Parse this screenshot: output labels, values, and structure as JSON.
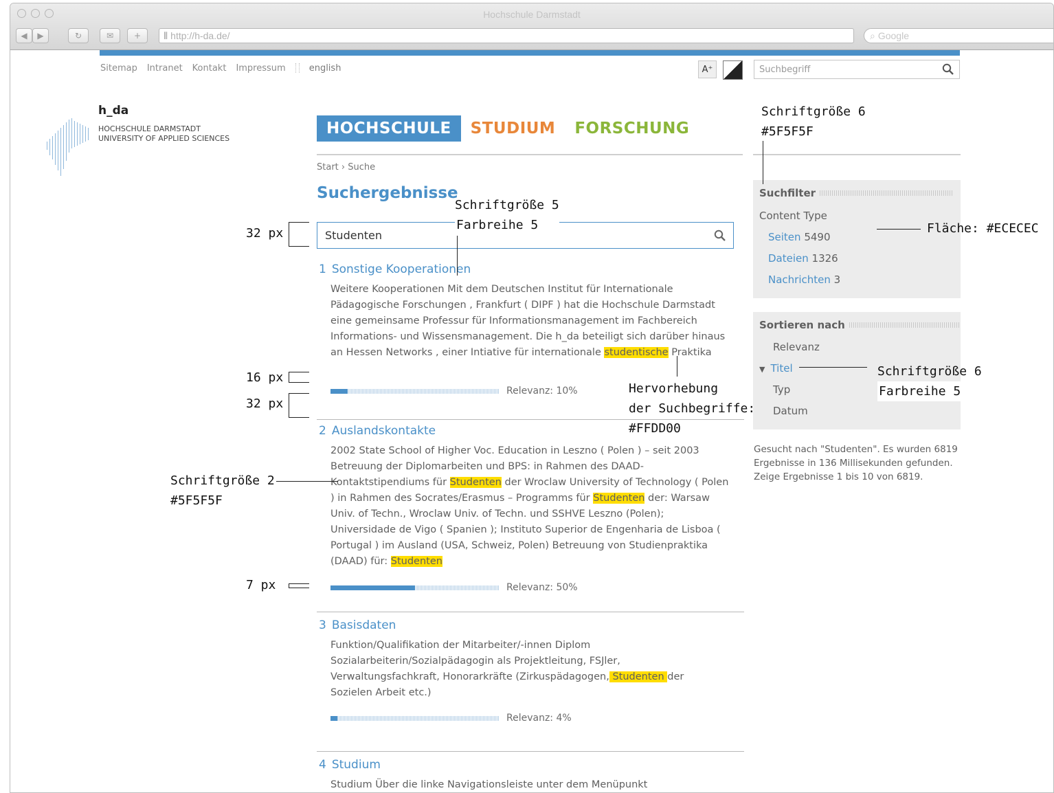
{
  "browser": {
    "title": "Hochschule Darmstadt",
    "url": "http://h-da.de/",
    "search_placeholder": "Google"
  },
  "utility_nav": {
    "items": [
      "Sitemap",
      "Intranet",
      "Kontakt",
      "Impressum"
    ],
    "language": "english",
    "font_size_button": "A⁺",
    "search_placeholder": "Suchbegriff"
  },
  "logo": {
    "name": "h_da",
    "line1": "HOCHSCHULE DARMSTADT",
    "line2": "UNIVERSITY OF APPLIED SCIENCES"
  },
  "main_nav": {
    "items": [
      "HOCHSCHULE",
      "STUDIUM",
      "FORSCHUNG"
    ],
    "colors": [
      "#4a90c8",
      "#e8873a",
      "#8bb63a"
    ]
  },
  "breadcrumb": {
    "start": "Start",
    "separator": "›",
    "current": "Suche"
  },
  "heading": "Suchergebnisse",
  "search": {
    "value": "Studenten"
  },
  "results": [
    {
      "num": "1",
      "title": "Sonstige Kooperationen",
      "text_before": "Weitere Kooperationen Mit dem Deutschen Institut für Internationale Pädagogische Forschungen , Frankfurt ( DIPF ) hat die Hochschule Darmstadt eine gemeinsame Professur für Informationsmanagement im Fachbereich Informations- und Wissensmanagement. Die h_da beteiligt sich darüber hinaus an Hessen Networks , einer Intiative für internationale ",
      "highlight": "studentische",
      "text_after": " Praktika",
      "relevance": 10,
      "relevance_label": "Relevanz: 10%"
    },
    {
      "num": "2",
      "title": "Auslandskontakte",
      "t1": "2002 State School of Higher Voc. Education in Leszno ( Polen ) – seit 2003 Betreuung der Diplomarbeiten und BPS: in Rahmen des DAAD-Kontaktstipendiums für ",
      "h1": "Studenten",
      "t2": " der Wroclaw University of Technology ( Polen ) in Rahmen des Socrates/Erasmus – Programms für ",
      "h2": "Studenten",
      "t3": " der: Warsaw Univ. of Techn., Wroclaw Univ. of Techn. und SSHVE Leszno (Polen); Universidade de Vigo ( Spanien ); Instituto Superior de Engenharia de Lisboa ( Portugal ) im Ausland (USA, Schweiz, Polen) Betreuung von Studienpraktika (DAAD) für: ",
      "h3": "Studenten",
      "relevance": 50,
      "relevance_label": "Relevanz: 50%"
    },
    {
      "num": "3",
      "title": "Basisdaten",
      "t1": "Funktion/Qualifikation der Mitarbeiter/-innen Diplom Sozialarbeiterin/Sozialpädagogin als Projektleitung, FSJler, Verwaltungsfachkraft, Honorarkräfte (Zirkuspädagogen,",
      "h1": " Studenten ",
      "t2": "der Sozielen Arbeit etc.)",
      "relevance": 4,
      "relevance_label": "Relevanz: 4%"
    },
    {
      "num": "4",
      "title": "Studium",
      "t1": "Studium Über die linke Navigationsleiste unter dem Menüpunkt"
    }
  ],
  "filter": {
    "heading": "Suchfilter",
    "subheading": "Content Type",
    "items": [
      {
        "label": "Seiten",
        "count": "5490"
      },
      {
        "label": "Dateien",
        "count": "1326"
      },
      {
        "label": "Nachrichten",
        "count": "3"
      }
    ]
  },
  "sort": {
    "heading": "Sortieren nach",
    "items": [
      "Relevanz",
      "Titel",
      "Typ",
      "Datum"
    ],
    "active": "Titel"
  },
  "status": "Gesucht nach \"Studenten\". Es wurden 6819 Ergebnisse in 136 Millisekunden gefunden. Zeige Ergebnisse 1 bis 10 von 6819.",
  "annotations": {
    "a1": [
      "Schriftgröße 6",
      "#5F5F5F"
    ],
    "a2": [
      "Schriftgröße 5",
      "Farbreihe 5"
    ],
    "a3": "Fläche: #ECECEC",
    "a4": [
      "Schriftgröße 6",
      "Farbreihe 5"
    ],
    "a5": [
      "Hervorhebung",
      "der Suchbegriffe:",
      "#FFDD00"
    ],
    "a6": [
      "Schriftgröße 2",
      "#5F5F5F"
    ],
    "px": [
      "32 px",
      "16 px",
      "32 px",
      "7 px"
    ]
  },
  "colors": {
    "accent": "#4a90c8",
    "highlight": "#ffdd00",
    "panel": "#ececec",
    "text": "#5f5f5f"
  }
}
